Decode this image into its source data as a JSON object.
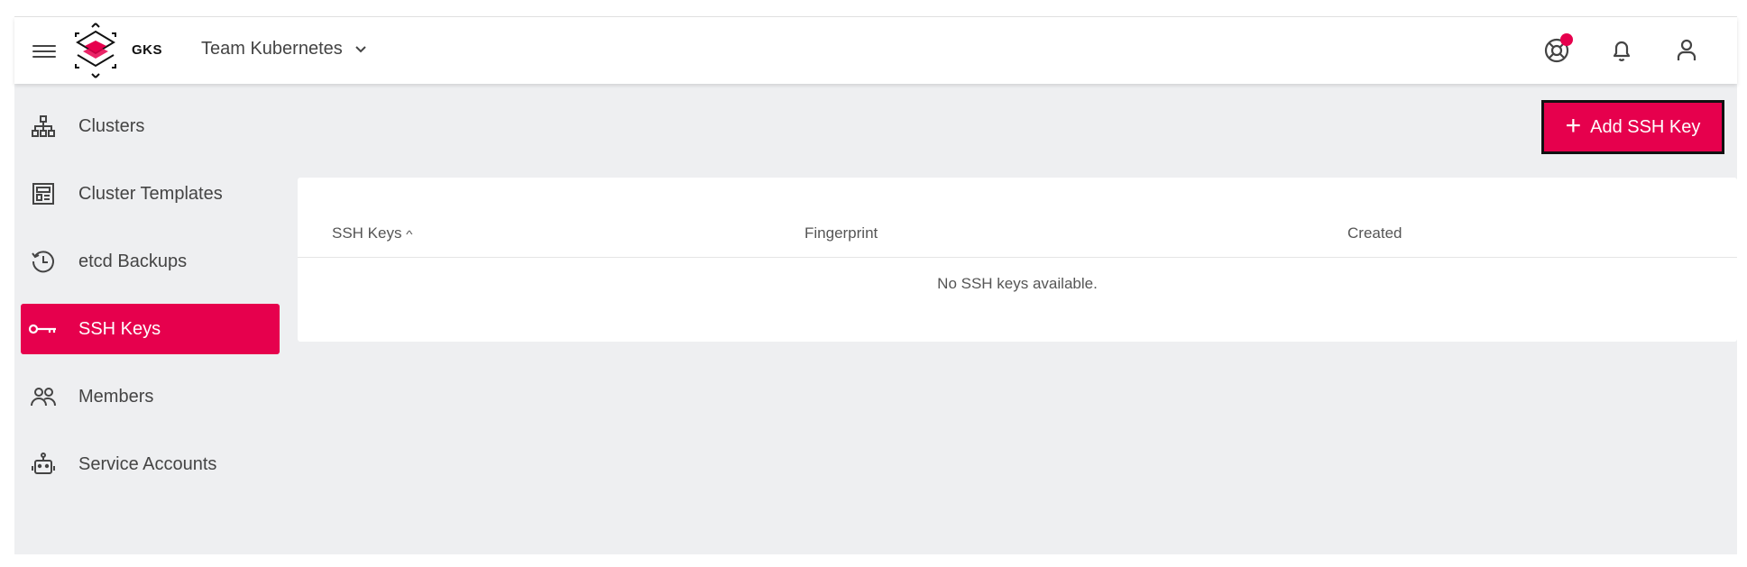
{
  "header": {
    "logo_text": "GKS",
    "project_name": "Team Kubernetes"
  },
  "sidebar": {
    "items": [
      {
        "label": "Clusters",
        "icon": "sitemap-icon"
      },
      {
        "label": "Cluster Templates",
        "icon": "template-icon"
      },
      {
        "label": "etcd Backups",
        "icon": "history-icon"
      },
      {
        "label": "SSH Keys",
        "icon": "key-icon",
        "active": true
      },
      {
        "label": "Members",
        "icon": "members-icon"
      },
      {
        "label": "Service Accounts",
        "icon": "robot-icon"
      }
    ]
  },
  "toolbar": {
    "add_label": "Add SSH Key"
  },
  "table": {
    "columns": [
      "SSH Keys",
      "Fingerprint",
      "Created"
    ],
    "sorted_column": "SSH Keys",
    "sort_direction": "ascending",
    "empty_message": "No SSH keys available."
  },
  "colors": {
    "accent": "#e6004d",
    "background": "#eeeff1"
  }
}
